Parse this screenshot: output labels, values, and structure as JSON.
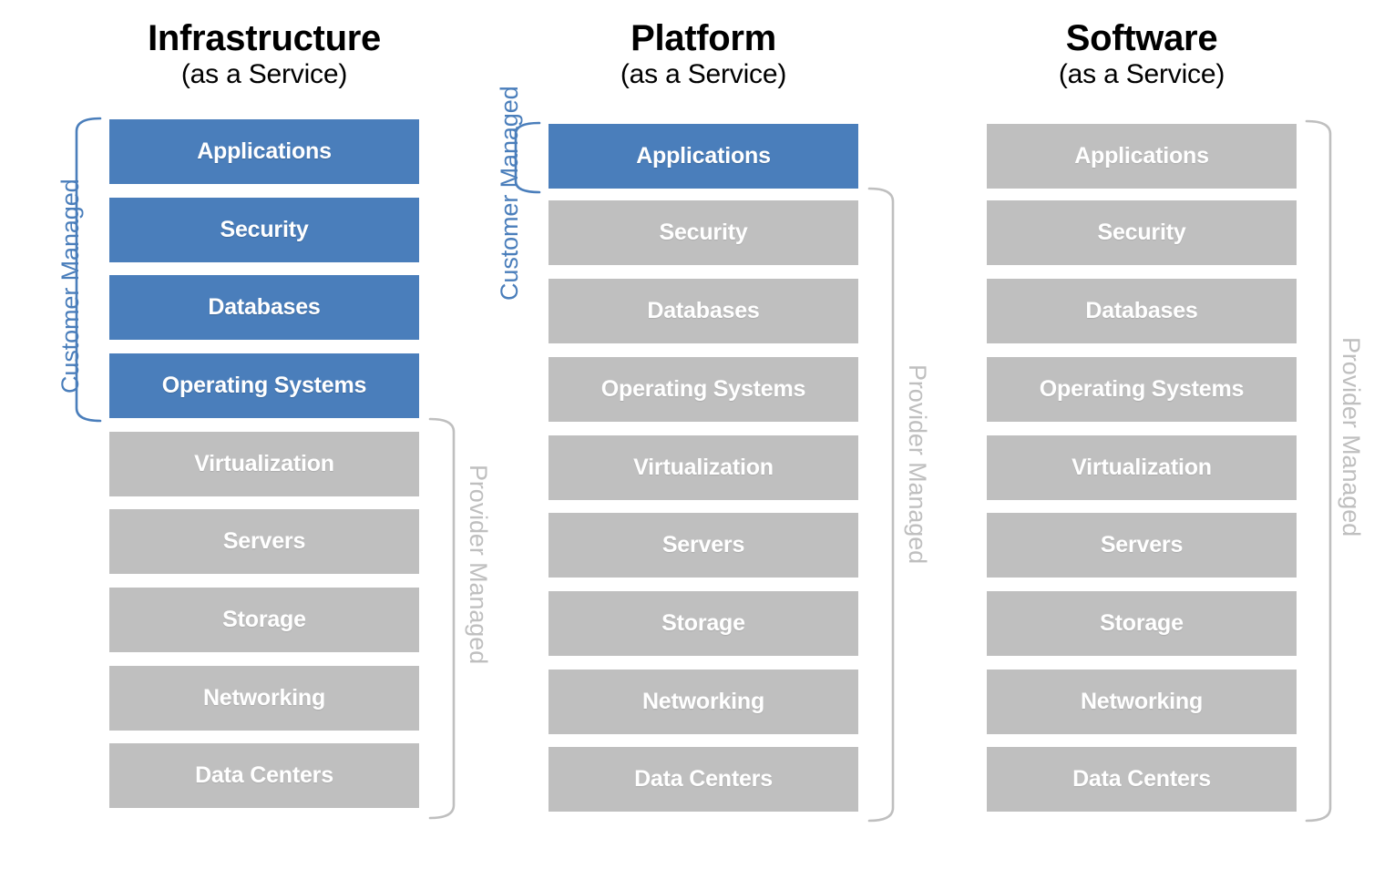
{
  "diagram": {
    "type": "cloud-service-model-responsibility-matrix",
    "layer_names": [
      "Applications",
      "Security",
      "Databases",
      "Operating Systems",
      "Virtualization",
      "Servers",
      "Storage",
      "Networking",
      "Data Centers"
    ],
    "colors": {
      "customer_managed": "#4A7EBB",
      "provider_managed": "#BFBFBF",
      "title": "#000000",
      "background": "#FFFFFF"
    },
    "labels": {
      "customer_managed": "Customer Managed",
      "provider_managed": "Provider Managed"
    }
  },
  "columns": [
    {
      "id": "iaas",
      "title": "Infrastructure",
      "subtitle": "(as a Service)",
      "customer_label": "Customer Managed",
      "provider_label": "Provider Managed",
      "customer_managed_count": 4,
      "provider_managed_count": 5,
      "layers": [
        {
          "label": "Applications",
          "owner": "customer"
        },
        {
          "label": "Security",
          "owner": "customer"
        },
        {
          "label": "Databases",
          "owner": "customer"
        },
        {
          "label": "Operating Systems",
          "owner": "customer"
        },
        {
          "label": "Virtualization",
          "owner": "provider"
        },
        {
          "label": "Servers",
          "owner": "provider"
        },
        {
          "label": "Storage",
          "owner": "provider"
        },
        {
          "label": "Networking",
          "owner": "provider"
        },
        {
          "label": "Data Centers",
          "owner": "provider"
        }
      ]
    },
    {
      "id": "paas",
      "title": "Platform",
      "subtitle": "(as a Service)",
      "customer_label": "Customer Managed",
      "provider_label": "Provider Managed",
      "customer_managed_count": 1,
      "provider_managed_count": 8,
      "layers": [
        {
          "label": "Applications",
          "owner": "customer"
        },
        {
          "label": "Security",
          "owner": "provider"
        },
        {
          "label": "Databases",
          "owner": "provider"
        },
        {
          "label": "Operating Systems",
          "owner": "provider"
        },
        {
          "label": "Virtualization",
          "owner": "provider"
        },
        {
          "label": "Servers",
          "owner": "provider"
        },
        {
          "label": "Storage",
          "owner": "provider"
        },
        {
          "label": "Networking",
          "owner": "provider"
        },
        {
          "label": "Data Centers",
          "owner": "provider"
        }
      ]
    },
    {
      "id": "saas",
      "title": "Software",
      "subtitle": "(as a Service)",
      "customer_label": "",
      "provider_label": "Provider Managed",
      "customer_managed_count": 0,
      "provider_managed_count": 9,
      "layers": [
        {
          "label": "Applications",
          "owner": "provider"
        },
        {
          "label": "Security",
          "owner": "provider"
        },
        {
          "label": "Databases",
          "owner": "provider"
        },
        {
          "label": "Operating Systems",
          "owner": "provider"
        },
        {
          "label": "Virtualization",
          "owner": "provider"
        },
        {
          "label": "Servers",
          "owner": "provider"
        },
        {
          "label": "Storage",
          "owner": "provider"
        },
        {
          "label": "Networking",
          "owner": "provider"
        },
        {
          "label": "Data Centers",
          "owner": "provider"
        }
      ]
    }
  ]
}
